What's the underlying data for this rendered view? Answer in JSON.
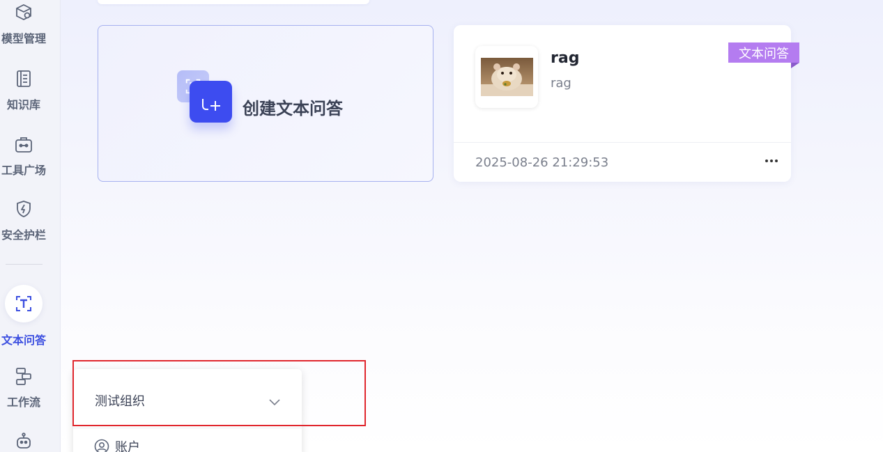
{
  "sidebar": {
    "items": [
      {
        "label": "模型管理",
        "icon": "model-icon"
      },
      {
        "label": "知识库",
        "icon": "book-icon"
      },
      {
        "label": "工具广场",
        "icon": "toolbox-icon"
      },
      {
        "label": "安全护栏",
        "icon": "shield-icon"
      },
      {
        "label": "文本问答",
        "icon": "text-qa-icon",
        "active": true
      },
      {
        "label": "工作流",
        "icon": "workflow-icon"
      },
      {
        "label": "",
        "icon": "robot-icon"
      }
    ],
    "active_color": "#3c4fe0"
  },
  "create_card": {
    "label": "创建文本问答"
  },
  "apps": [
    {
      "name": "rag",
      "description": "rag",
      "tag": "文本问答",
      "timestamp": "2025-08-26 21:29:53",
      "thumbnail": "hamster-image"
    }
  ],
  "org_menu": {
    "org_name": "测试组织",
    "account_label": "账户"
  },
  "colors": {
    "primary": "#3d4cf0",
    "tag": "#b47cf0",
    "highlight": "#e0262d"
  }
}
